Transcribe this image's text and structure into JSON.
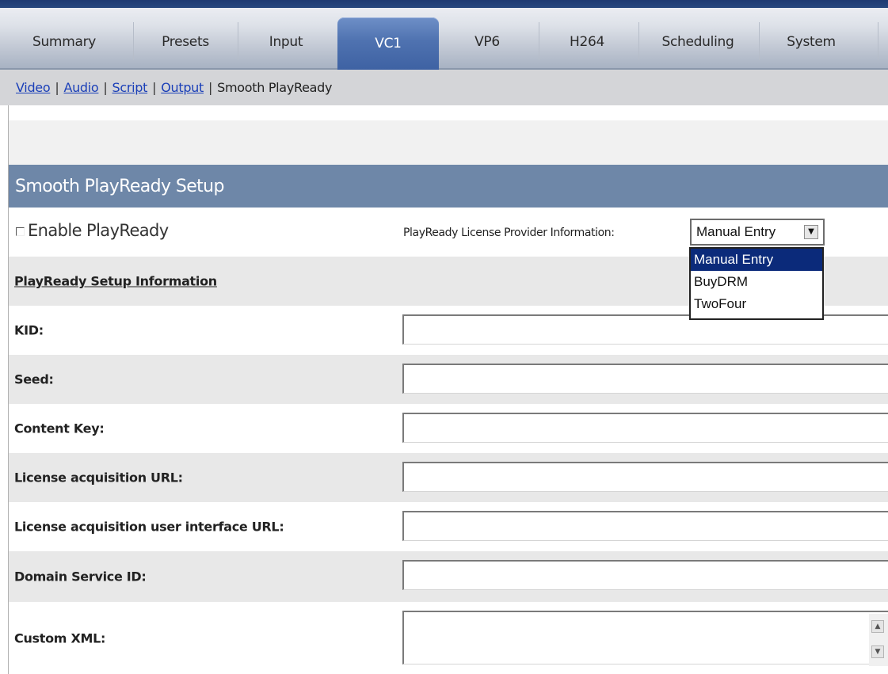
{
  "tabs": [
    {
      "label": "Summary",
      "active": false
    },
    {
      "label": "Presets",
      "active": false
    },
    {
      "label": "Input",
      "active": false
    },
    {
      "label": "VC1",
      "active": true
    },
    {
      "label": "VP6",
      "active": false
    },
    {
      "label": "H264",
      "active": false
    },
    {
      "label": "Scheduling",
      "active": false
    },
    {
      "label": "System",
      "active": false
    }
  ],
  "subnav": {
    "links": [
      "Video",
      "Audio",
      "Script",
      "Output"
    ],
    "current": "Smooth PlayReady",
    "separator": "|"
  },
  "section": {
    "title": "Smooth PlayReady Setup"
  },
  "enable": {
    "label": "Enable PlayReady",
    "checked": false
  },
  "provider": {
    "label": "PlayReady License Provider Information:",
    "selected": "Manual Entry",
    "options": [
      "Manual Entry",
      "BuyDRM",
      "TwoFour"
    ],
    "dropdown_open": true
  },
  "setup_info": {
    "label": "PlayReady Setup Information"
  },
  "fields": [
    {
      "label": "KID:",
      "value": ""
    },
    {
      "label": "Seed:",
      "value": ""
    },
    {
      "label": "Content Key:",
      "value": ""
    },
    {
      "label": "License acquisition URL:",
      "value": ""
    },
    {
      "label": "License acquisition user interface URL:",
      "value": ""
    },
    {
      "label": "Domain Service ID:",
      "value": ""
    }
  ],
  "custom_xml": {
    "label": "Custom XML:",
    "value": ""
  },
  "icons": {
    "dropdown_arrow": "chevron-down-icon",
    "scroll_up": "scroll-up-icon",
    "scroll_down": "scroll-down-icon"
  },
  "colors": {
    "active_tab": "#4f72b0",
    "section_header": "#6e87a8",
    "link": "#1a3fb8",
    "selected_option": "#0b2a7a"
  }
}
